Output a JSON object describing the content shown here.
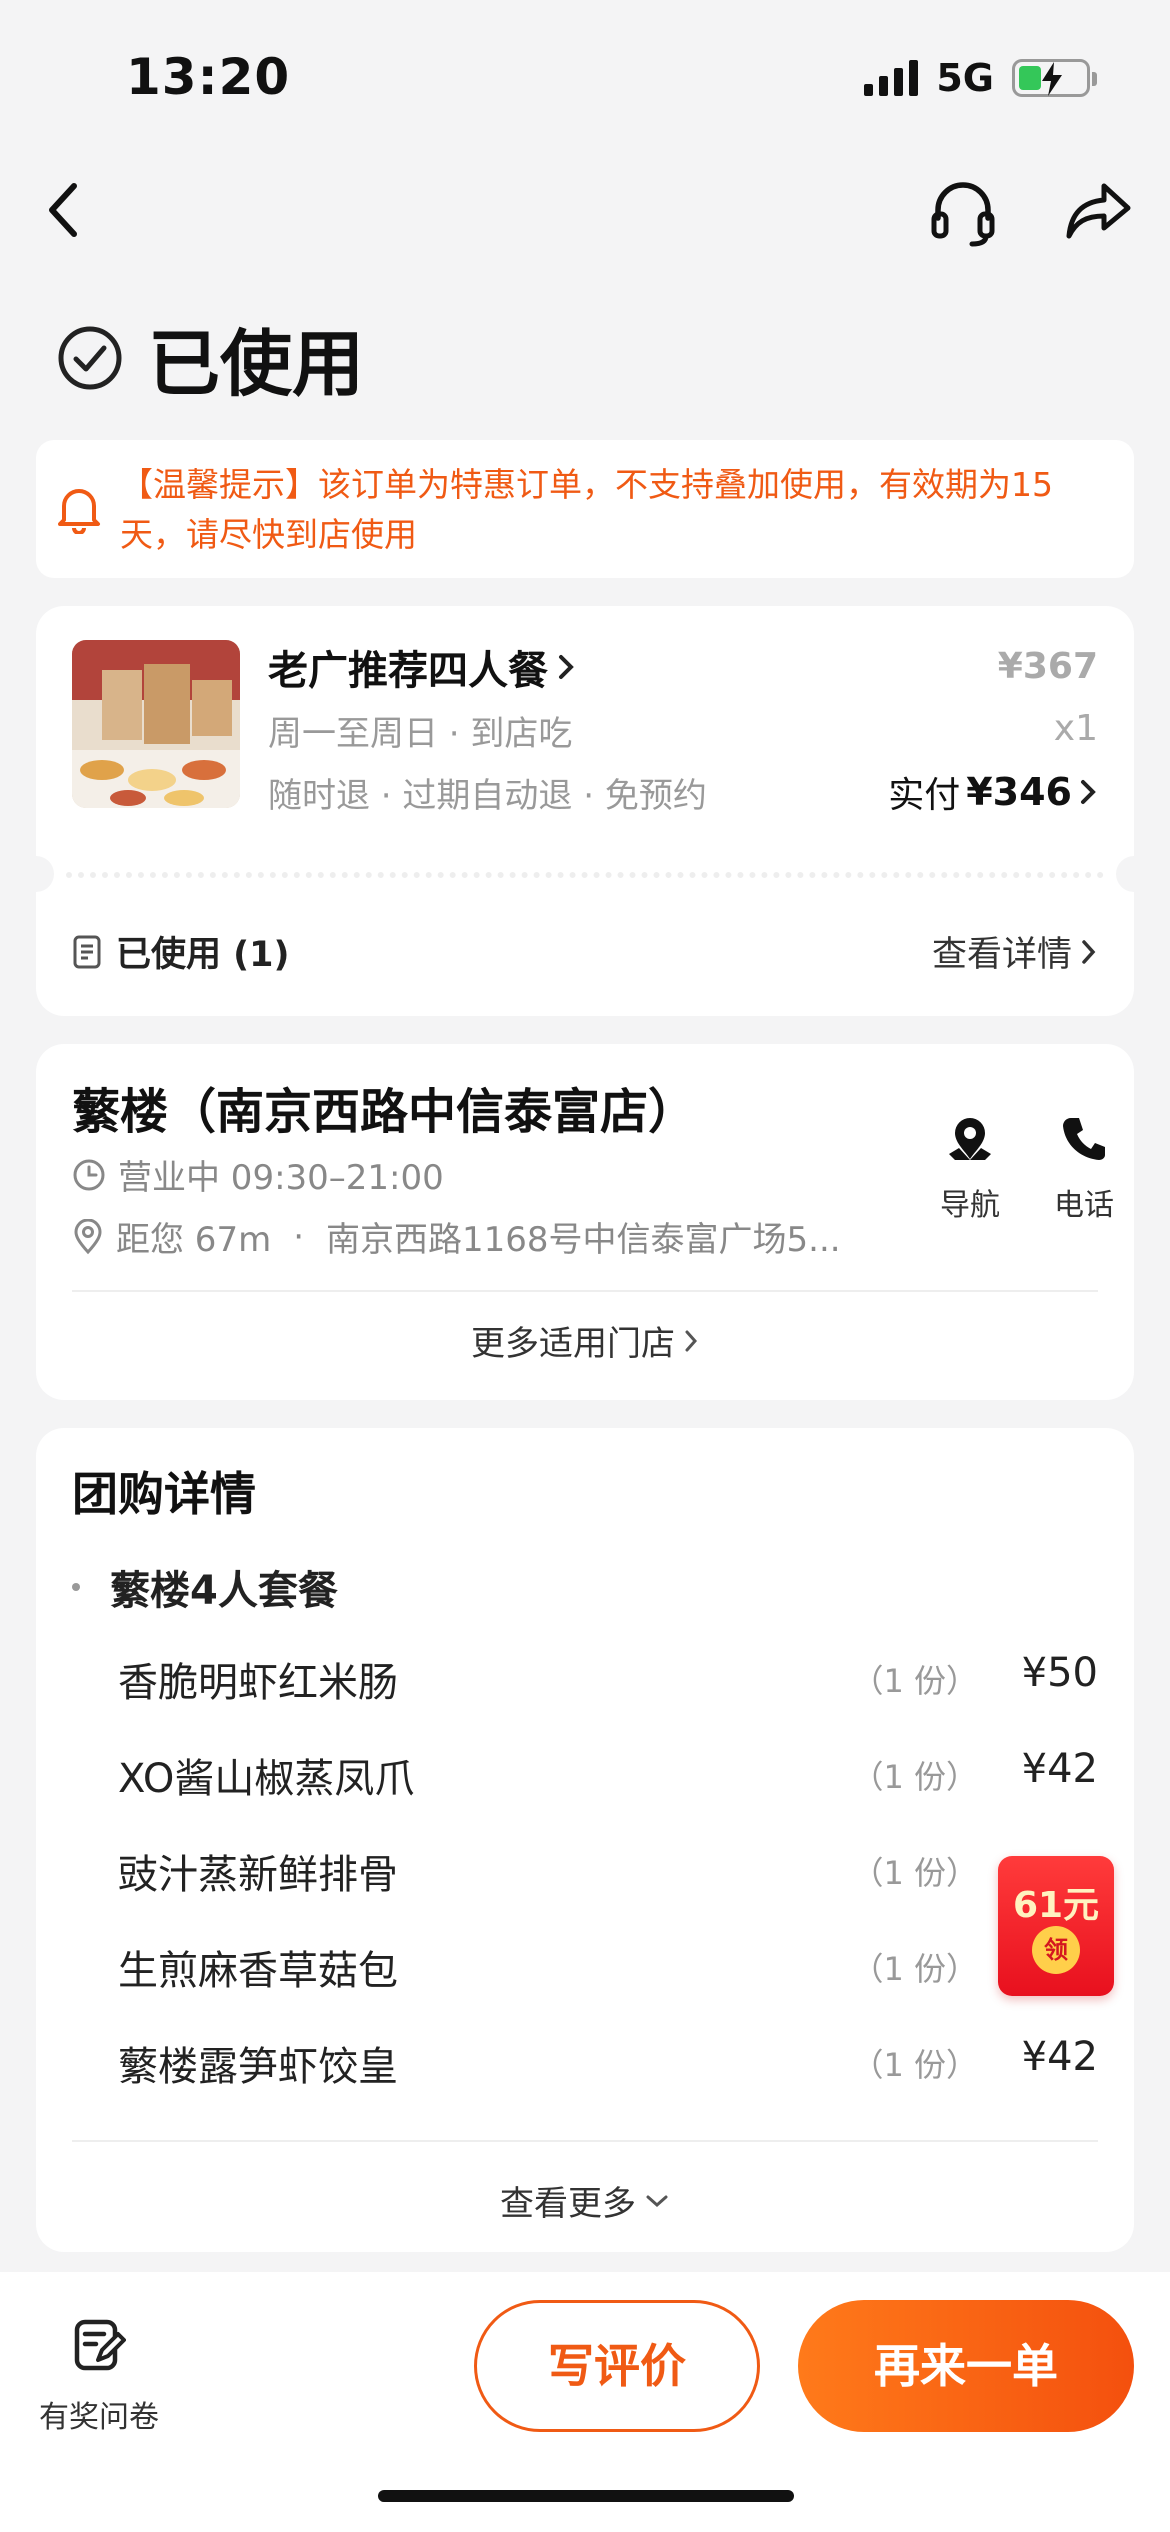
{
  "status_bar": {
    "time": "13:20",
    "network": "5G"
  },
  "page": {
    "title": "已使用"
  },
  "notice": {
    "text": "【温馨提示】该订单为特惠订单，不支持叠加使用，有效期为15天，请尽快到店使用"
  },
  "order": {
    "product_name": "老广推荐四人餐",
    "subtitle1": "周一至周日 · 到店吃",
    "subtitle2": "随时退 · 过期自动退 · 免预约",
    "original_price": "¥367",
    "quantity": "x1",
    "paid_label": "实付",
    "paid_amount": "¥346",
    "used_status": "已使用 (1)",
    "detail_link": "查看详情"
  },
  "store": {
    "name": "蘩楼（南京西路中信泰富店）",
    "hours": "营业中 09:30–21:00",
    "distance": "距您 67m",
    "separator": "·",
    "address": "南京西路1168号中信泰富广场5...",
    "navigate_label": "导航",
    "call_label": "电话",
    "more_stores": "更多适用门店"
  },
  "deal": {
    "title": "团购详情",
    "set_name": "蘩楼4人套餐",
    "items": [
      {
        "name": "香脆明虾红米肠",
        "qty": "（1 份）",
        "price": "¥50"
      },
      {
        "name": "XO酱山椒蒸凤爪",
        "qty": "（1 份）",
        "price": "¥42"
      },
      {
        "name": "豉汁蒸新鲜排骨",
        "qty": "（1 份）",
        "price": ""
      },
      {
        "name": "生煎麻香草菇包",
        "qty": "（1 份）",
        "price": ""
      },
      {
        "name": "蘩楼露笋虾饺皇",
        "qty": "（1 份）",
        "price": "¥42"
      }
    ],
    "see_more": "查看更多"
  },
  "red_packet": {
    "amount": "61元",
    "claim": "领"
  },
  "bottom_bar": {
    "survey_label": "有奖问卷",
    "review_button": "写评价",
    "reorder_button": "再来一单"
  },
  "colors": {
    "accent": "#f05a14",
    "background": "#f4f4f5"
  }
}
